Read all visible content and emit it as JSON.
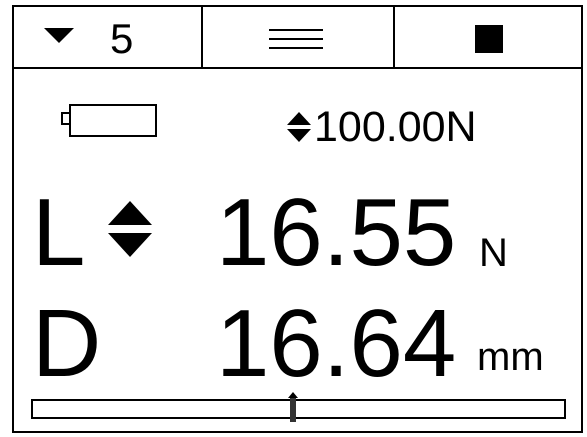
{
  "header": {
    "dropdown_value": "5",
    "menu_icon": "menu-icon",
    "stop_icon": "stop-icon"
  },
  "status": {
    "battery_icon": "battery-icon",
    "setpoint": "100.00N"
  },
  "readings": [
    {
      "label": "L",
      "value": "16.55",
      "unit": "N"
    },
    {
      "label": "D",
      "value": "16.64",
      "unit": "mm"
    }
  ],
  "progress": {
    "position_fraction": 0.49
  }
}
